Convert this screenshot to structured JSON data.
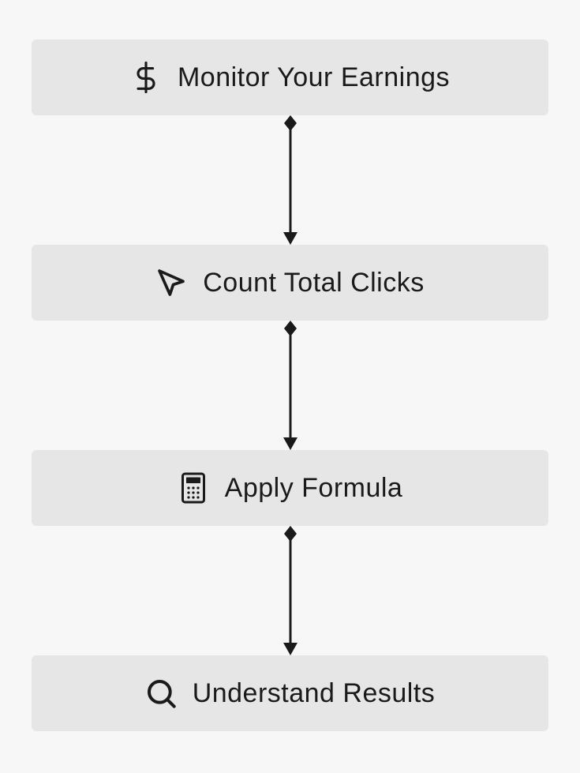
{
  "steps": [
    {
      "icon": "dollar-icon",
      "label": "Monitor Your Earnings"
    },
    {
      "icon": "cursor-icon",
      "label": "Count Total Clicks"
    },
    {
      "icon": "calculator-icon",
      "label": "Apply Formula"
    },
    {
      "icon": "magnifier-icon",
      "label": "Understand Results"
    }
  ],
  "colors": {
    "bg": "#f7f7f7",
    "box": "#e6e6e6",
    "text": "#1a1a1a",
    "stroke": "#1a1a1a"
  }
}
